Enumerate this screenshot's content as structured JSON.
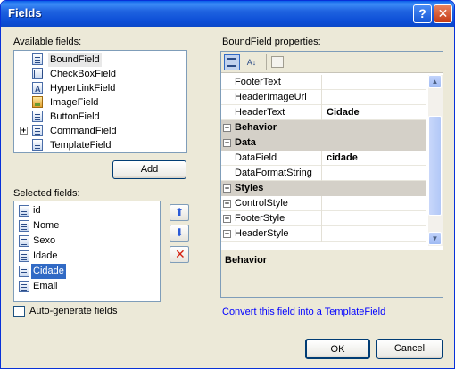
{
  "window": {
    "title": "Fields",
    "help_glyph": "?",
    "close_glyph": "✕"
  },
  "available": {
    "label": "Available fields:",
    "items": [
      {
        "label": "BoundField",
        "icon": "boundfield-icon"
      },
      {
        "label": "CheckBoxField",
        "icon": "checkbox-field-icon"
      },
      {
        "label": "HyperLinkField",
        "icon": "hyperlink-field-icon"
      },
      {
        "label": "ImageField",
        "icon": "image-field-icon"
      },
      {
        "label": "ButtonField",
        "icon": "button-field-icon"
      },
      {
        "label": "CommandField",
        "icon": "command-field-icon"
      },
      {
        "label": "TemplateField",
        "icon": "template-field-icon"
      }
    ],
    "expand_glyph": "+",
    "add_label": "Add"
  },
  "selected": {
    "label": "Selected fields:",
    "items": [
      "id",
      "Nome",
      "Sexo",
      "Idade",
      "Cidade",
      "Email"
    ],
    "selected_item": "Cidade",
    "up_glyph": "⬆",
    "down_glyph": "⬇",
    "delete_glyph": "✕"
  },
  "autogen": {
    "label": "Auto-generate fields",
    "checked": false
  },
  "properties": {
    "label": "BoundField properties:",
    "toolbar_sort_glyph": "A↓",
    "rows": [
      {
        "kind": "prop",
        "key": "FooterText",
        "value": ""
      },
      {
        "kind": "prop",
        "key": "HeaderImageUrl",
        "value": ""
      },
      {
        "kind": "prop",
        "key": "HeaderText",
        "value": "Cidade"
      },
      {
        "kind": "cat",
        "key": "Behavior",
        "value": ""
      },
      {
        "kind": "cat",
        "key": "Data",
        "value": ""
      },
      {
        "kind": "prop",
        "key": "DataField",
        "value": "cidade"
      },
      {
        "kind": "prop",
        "key": "DataFormatString",
        "value": ""
      },
      {
        "kind": "cat",
        "key": "Styles",
        "value": ""
      },
      {
        "kind": "prop",
        "key": "ControlStyle",
        "value": ""
      },
      {
        "kind": "prop",
        "key": "FooterStyle",
        "value": ""
      },
      {
        "kind": "prop",
        "key": "HeaderStyle",
        "value": ""
      }
    ],
    "plus_glyph": "+",
    "minus_glyph": "−",
    "description_title": "Behavior"
  },
  "convert_link": "Convert this field into a TemplateField",
  "buttons": {
    "ok": "OK",
    "cancel": "Cancel"
  },
  "colors": {
    "selection": "#316ac5",
    "title_bar": "#0c4dd6",
    "dialog_face": "#ece9d8"
  }
}
